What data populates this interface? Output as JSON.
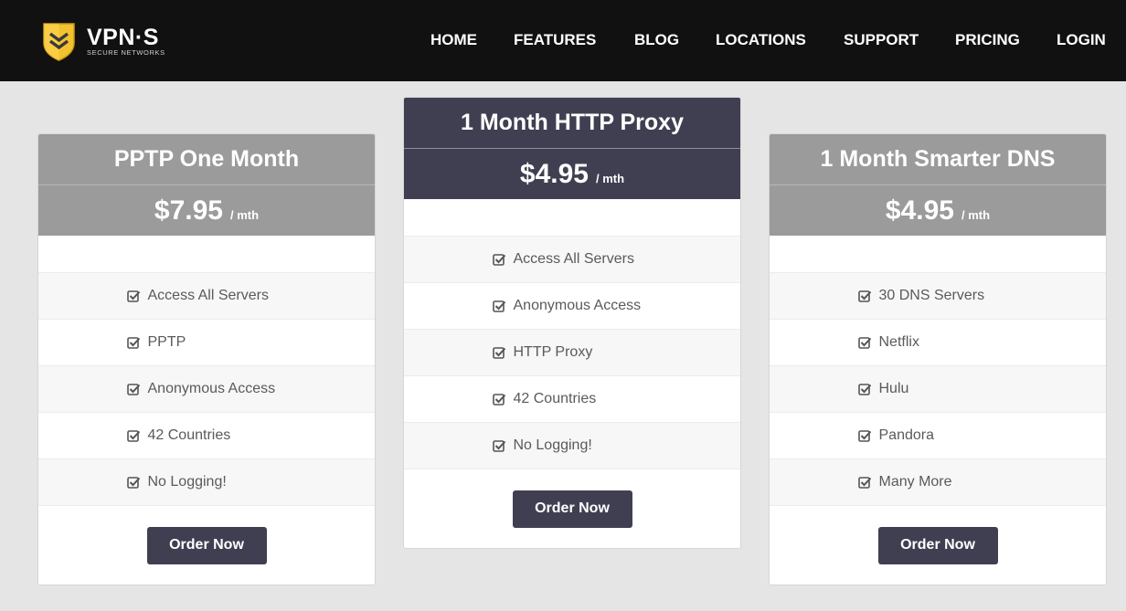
{
  "brand": {
    "name": "VPN·S",
    "tagline": "SECURE NETWORKS",
    "accent_color": "#f2c230",
    "icon": "shield-chevron-logo"
  },
  "nav": {
    "items": [
      {
        "label": "HOME"
      },
      {
        "label": "FEATURES"
      },
      {
        "label": "BLOG"
      },
      {
        "label": "LOCATIONS"
      },
      {
        "label": "SUPPORT"
      },
      {
        "label": "PRICING"
      },
      {
        "label": "LOGIN"
      }
    ]
  },
  "colors": {
    "header_bg": "#111111",
    "page_bg": "#e5e5e5",
    "card_gray": "#9b9b9b",
    "card_dark": "#403f52",
    "button_bg": "#403f52"
  },
  "plans": [
    {
      "title": "PPTP One Month",
      "price": "$7.95",
      "unit": "/ mth",
      "features": [
        "Access All Servers",
        "PPTP",
        "Anonymous Access",
        "42 Countries",
        "No Logging!"
      ],
      "button": "Order Now"
    },
    {
      "title": "1 Month HTTP Proxy",
      "price": "$4.95",
      "unit": "/ mth",
      "features": [
        "Access All Servers",
        "Anonymous Access",
        "HTTP Proxy",
        "42 Countries",
        "No Logging!"
      ],
      "button": "Order Now"
    },
    {
      "title": "1 Month Smarter DNS",
      "price": "$4.95",
      "unit": "/ mth",
      "features": [
        "30 DNS Servers",
        "Netflix",
        "Hulu",
        "Pandora",
        "Many More"
      ],
      "button": "Order Now"
    }
  ],
  "feature_icon": "checkbox-checked-icon"
}
